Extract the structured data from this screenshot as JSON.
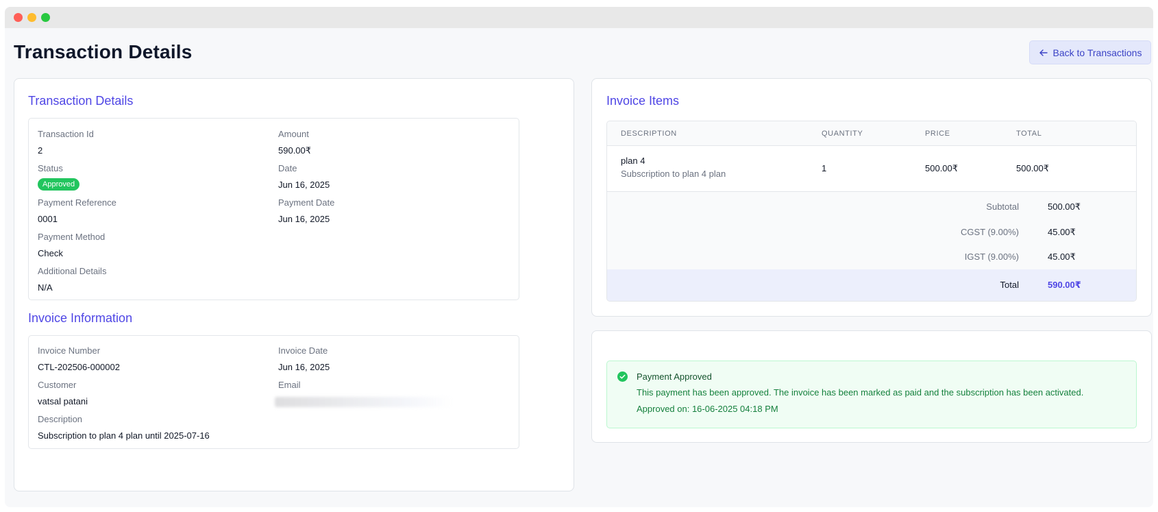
{
  "page": {
    "title": "Transaction Details",
    "back_button": "Back to Transactions"
  },
  "transaction": {
    "section_title": "Transaction Details",
    "transaction_id_label": "Transaction Id",
    "transaction_id": "2",
    "amount_label": "Amount",
    "amount": "590.00₹",
    "status_label": "Status",
    "status": "Approved",
    "date_label": "Date",
    "date": "Jun 16, 2025",
    "payment_reference_label": "Payment Reference",
    "payment_reference": "0001",
    "payment_date_label": "Payment Date",
    "payment_date": "Jun 16, 2025",
    "payment_method_label": "Payment Method",
    "payment_method": "Check",
    "additional_details_label": "Additional Details",
    "additional_details": "N/A"
  },
  "invoice": {
    "section_title": "Invoice Information",
    "invoice_number_label": "Invoice Number",
    "invoice_number": "CTL-202506-000002",
    "invoice_date_label": "Invoice Date",
    "invoice_date": "Jun 16, 2025",
    "customer_label": "Customer",
    "customer": "vatsal patani",
    "email_label": "Email",
    "description_label": "Description",
    "description": "Subscription to plan 4 plan until 2025-07-16"
  },
  "items": {
    "section_title": "Invoice Items",
    "headers": [
      "DESCRIPTION",
      "QUANTITY",
      "PRICE",
      "TOTAL"
    ],
    "rows": [
      {
        "name": "plan 4",
        "detail": "Subscription to plan 4 plan",
        "quantity": "1",
        "price": "500.00₹",
        "total": "500.00₹"
      }
    ],
    "subtotal_label": "Subtotal",
    "subtotal": "500.00₹",
    "cgst_label": "CGST (9.00%)",
    "cgst": "45.00₹",
    "igst_label": "IGST (9.00%)",
    "igst": "45.00₹",
    "total_label": "Total",
    "total": "590.00₹"
  },
  "status_alert": {
    "title": "Payment Approved",
    "message": "This payment has been approved. The invoice has been marked as paid and the subscription has been activated.",
    "approved_on": "Approved on: 16-06-2025 04:18 PM"
  },
  "colors": {
    "accent": "#4f46e5",
    "success": "#22c55e",
    "alert_bg": "#f0fdf4"
  }
}
